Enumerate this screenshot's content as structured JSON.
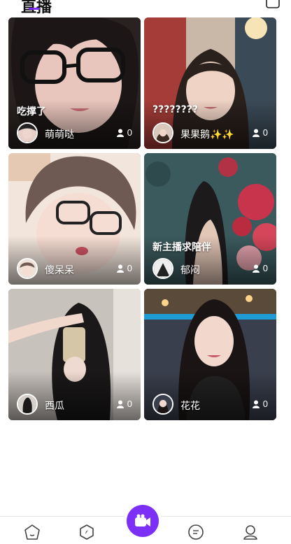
{
  "header": {
    "title": "直播",
    "accent_color": "#7b2ff7",
    "right_icon": "camera-icon"
  },
  "cards": [
    {
      "caption": "吃撑了",
      "name": "萌萌哒",
      "viewers": "0"
    },
    {
      "caption": "????????",
      "name": "果果鹅✨✨",
      "viewers": "0"
    },
    {
      "caption": "",
      "name": "傻呆呆",
      "viewers": "0"
    },
    {
      "caption": "新主播求陪伴",
      "name": "郁闷",
      "viewers": "0"
    },
    {
      "caption": "",
      "name": "西瓜",
      "viewers": "0"
    },
    {
      "caption": "",
      "name": "花花",
      "viewers": "0"
    }
  ],
  "tabbar": {
    "items": [
      "home-icon",
      "compass-icon",
      "live-camera-icon",
      "message-icon",
      "profile-icon"
    ]
  }
}
